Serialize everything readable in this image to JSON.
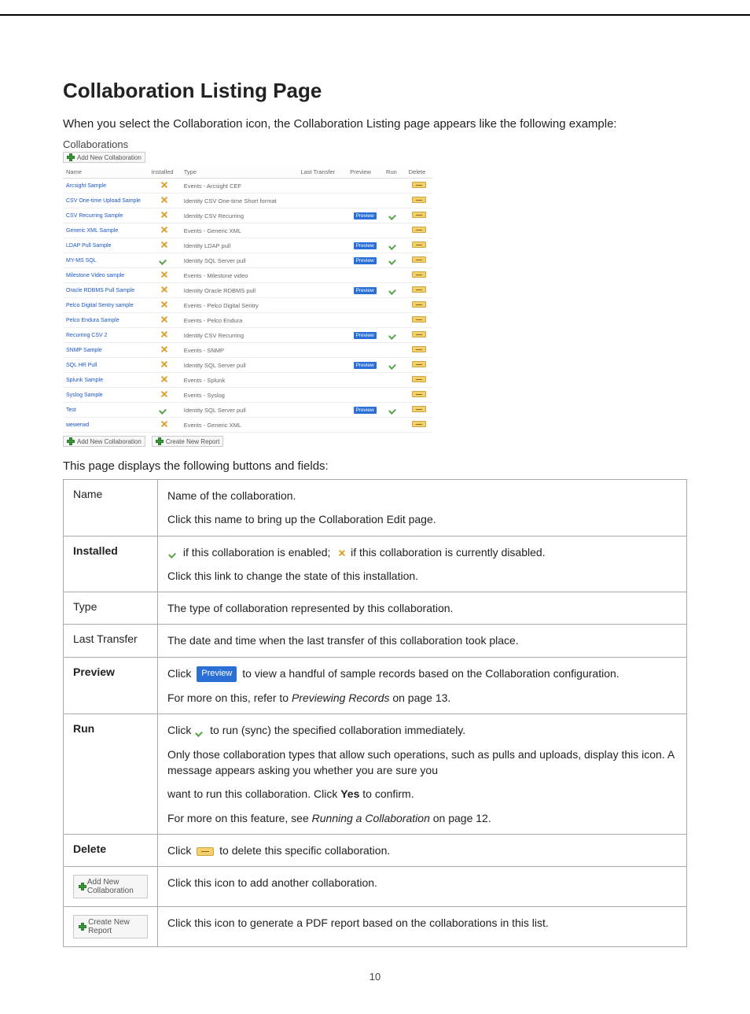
{
  "page": {
    "title": "Collaboration Listing Page",
    "intro": "When you select the Collaboration icon, the Collaboration Listing page appears like the following example:",
    "desc_text": "This page displays the following buttons and fields:",
    "page_number": "10"
  },
  "screenshot": {
    "title": "Collaborations",
    "add_label": "Add New Collaboration",
    "create_report_label": "Create New Report",
    "headers": {
      "name": "Name",
      "installed": "Installed",
      "type": "Type",
      "last_transfer": "Last Transfer",
      "preview": "Preview",
      "run": "Run",
      "delete": "Delete"
    },
    "preview_btn": "Preview",
    "rows": [
      {
        "name": "Arcsight Sample",
        "installed": "x",
        "type": "Events - Arcsight CEF",
        "preview": false,
        "run": false
      },
      {
        "name": "CSV One-time Upload Sample",
        "installed": "x",
        "type": "Identity CSV One-time Short format",
        "preview": false,
        "run": false
      },
      {
        "name": "CSV Recurring Sample",
        "installed": "x",
        "type": "Identity CSV Recurring",
        "preview": true,
        "run": true
      },
      {
        "name": "Generic XML Sample",
        "installed": "x",
        "type": "Events - Generic XML",
        "preview": false,
        "run": false
      },
      {
        "name": "LDAP Pull Sample",
        "installed": "x",
        "type": "Identity LDAP pull",
        "preview": true,
        "run": true
      },
      {
        "name": "MY-MS SQL",
        "installed": "check",
        "type": "Identity SQL Server pull",
        "preview": true,
        "run": true
      },
      {
        "name": "Milestone Video sample",
        "installed": "x",
        "type": "Events - Milestone video",
        "preview": false,
        "run": false
      },
      {
        "name": "Oracle RDBMS Pull Sample",
        "installed": "x",
        "type": "Identity Oracle RDBMS pull",
        "preview": true,
        "run": true
      },
      {
        "name": "Pelco Digital Sentry sample",
        "installed": "x",
        "type": "Events - Pelco Digital Sentry",
        "preview": false,
        "run": false
      },
      {
        "name": "Pelco Endura Sample",
        "installed": "x",
        "type": "Events - Pelco Endura",
        "preview": false,
        "run": false
      },
      {
        "name": "Recurring CSV 2",
        "installed": "x",
        "type": "Identity CSV Recurring",
        "preview": true,
        "run": true
      },
      {
        "name": "SNMP Sample",
        "installed": "x",
        "type": "Events - SNMP",
        "preview": false,
        "run": false
      },
      {
        "name": "SQL HR Pull",
        "installed": "x",
        "type": "Identity SQL Server pull",
        "preview": true,
        "run": true
      },
      {
        "name": "Splunk Sample",
        "installed": "x",
        "type": "Events - Splunk",
        "preview": false,
        "run": false
      },
      {
        "name": "Syslog Sample",
        "installed": "x",
        "type": "Events - Syslog",
        "preview": false,
        "run": false
      },
      {
        "name": "Test",
        "installed": "check",
        "type": "Identity SQL Server pull",
        "preview": true,
        "run": true
      },
      {
        "name": "wewerwd",
        "installed": "x",
        "type": "Events - Generic XML",
        "preview": false,
        "run": false
      }
    ]
  },
  "fields_table": {
    "name": {
      "label": "Name",
      "p1": "Name of the collaboration.",
      "p2": "Click this name to bring up the Collaboration Edit page."
    },
    "installed": {
      "label": "Installed",
      "enabled_text": "if this collaboration is enabled;",
      "disabled_text": "if this collaboration is currently disabled.",
      "p2": "Click this link to change the state of this installation."
    },
    "type": {
      "label": "Type",
      "p1": "The type of collaboration represented by this collaboration."
    },
    "last_transfer": {
      "label": "Last Transfer",
      "p1": "The date and time when the last transfer of this collaboration took place."
    },
    "preview": {
      "label": "Preview",
      "click": "Click",
      "preview_btn": "Preview",
      "after": "to view a handful of sample records based on the Collaboration configuration.",
      "p2a": "For more on this, refer to ",
      "p2_ref": "Previewing Records",
      "p2b": " on page 13."
    },
    "run": {
      "label": "Run",
      "click": "Click",
      "after1": "to run (sync) the specified collaboration immediately.",
      "p2": "Only those collaboration types that allow such operations, such as pulls and uploads, display this icon. A message appears asking you whether you are sure you",
      "p3a": "want to run this collaboration. Click ",
      "yes": "Yes",
      "p3b": " to confirm.",
      "p4a": "For more on this feature, see ",
      "p4_ref": "Running a Collaboration",
      "p4b": " on page 12."
    },
    "delete": {
      "label": "Delete",
      "click": "Click",
      "after": "to delete this specific collaboration."
    },
    "add_new": {
      "btn": "Add New Collaboration",
      "desc": "Click this icon to add another collaboration."
    },
    "create_report": {
      "btn": "Create New Report",
      "desc": "Click this icon to generate a PDF report based on the collaborations in this list."
    }
  }
}
